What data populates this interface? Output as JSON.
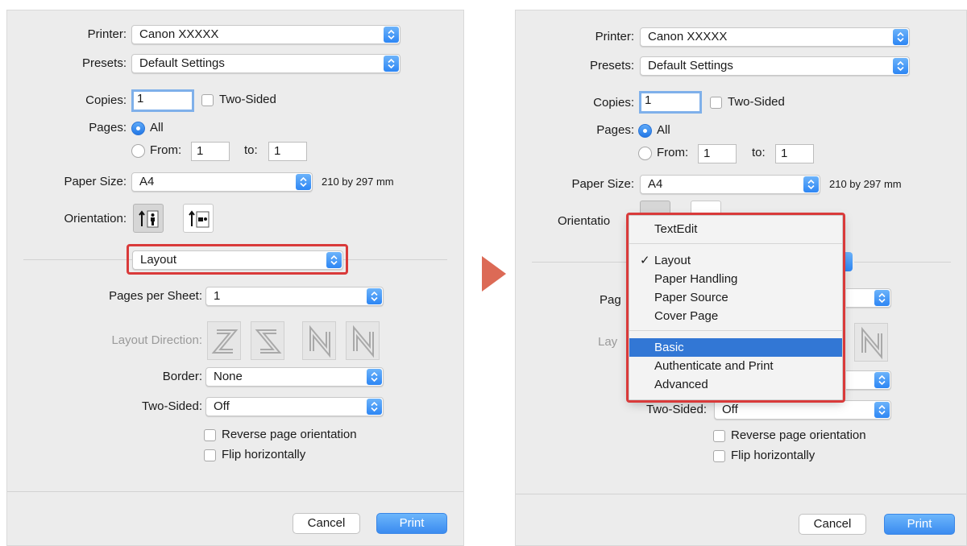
{
  "left": {
    "printer_label": "Printer:",
    "printer_value": "Canon XXXXX",
    "presets_label": "Presets:",
    "presets_value": "Default Settings",
    "copies_label": "Copies:",
    "copies_value": "1",
    "two_sided_label": "Two-Sided",
    "pages_label": "Pages:",
    "all_label": "All",
    "from_label": "From:",
    "from_value": "1",
    "to_label": "to:",
    "to_value": "1",
    "paper_size_label": "Paper Size:",
    "paper_size_value": "A4",
    "paper_dims": "210 by 297 mm",
    "orientation_label": "Orientation:",
    "section_value": "Layout",
    "pages_per_sheet_label": "Pages per Sheet:",
    "pages_per_sheet_value": "1",
    "layout_direction_label": "Layout Direction:",
    "border_label": "Border:",
    "border_value": "None",
    "two_sided_popup_label": "Two-Sided:",
    "two_sided_popup_value": "Off",
    "reverse_label": "Reverse page orientation",
    "flip_label": "Flip horizontally",
    "cancel_label": "Cancel",
    "print_label": "Print"
  },
  "right": {
    "printer_label": "Printer:",
    "printer_value": "Canon XXXXX",
    "presets_label": "Presets:",
    "presets_value": "Default Settings",
    "copies_label": "Copies:",
    "copies_value": "1",
    "two_sided_label": "Two-Sided",
    "pages_label": "Pages:",
    "all_label": "All",
    "from_label": "From:",
    "from_value": "1",
    "to_label": "to:",
    "to_value": "1",
    "paper_size_label": "Paper Size:",
    "paper_size_value": "A4",
    "paper_dims": "210 by 297 mm",
    "orientation_label_partial": "Orientatio",
    "pages_partial": "Pag",
    "layout_partial": "Lay",
    "two_sided_popup_label": "Two-Sided:",
    "two_sided_popup_value": "Off",
    "reverse_label": "Reverse page orientation",
    "flip_label": "Flip horizontally",
    "cancel_label": "Cancel",
    "print_label": "Print",
    "menu": {
      "items": [
        "TextEdit",
        "Layout",
        "Paper Handling",
        "Paper Source",
        "Cover Page",
        "Basic",
        "Authenticate and Print",
        "Advanced"
      ],
      "checked_item": "Layout",
      "selected_item": "Basic"
    }
  },
  "colors": {
    "accent": "#3277d5",
    "highlight_border": "#d93a3a",
    "arrow": "#dc6a56",
    "print_button": "#3b8bf0"
  }
}
